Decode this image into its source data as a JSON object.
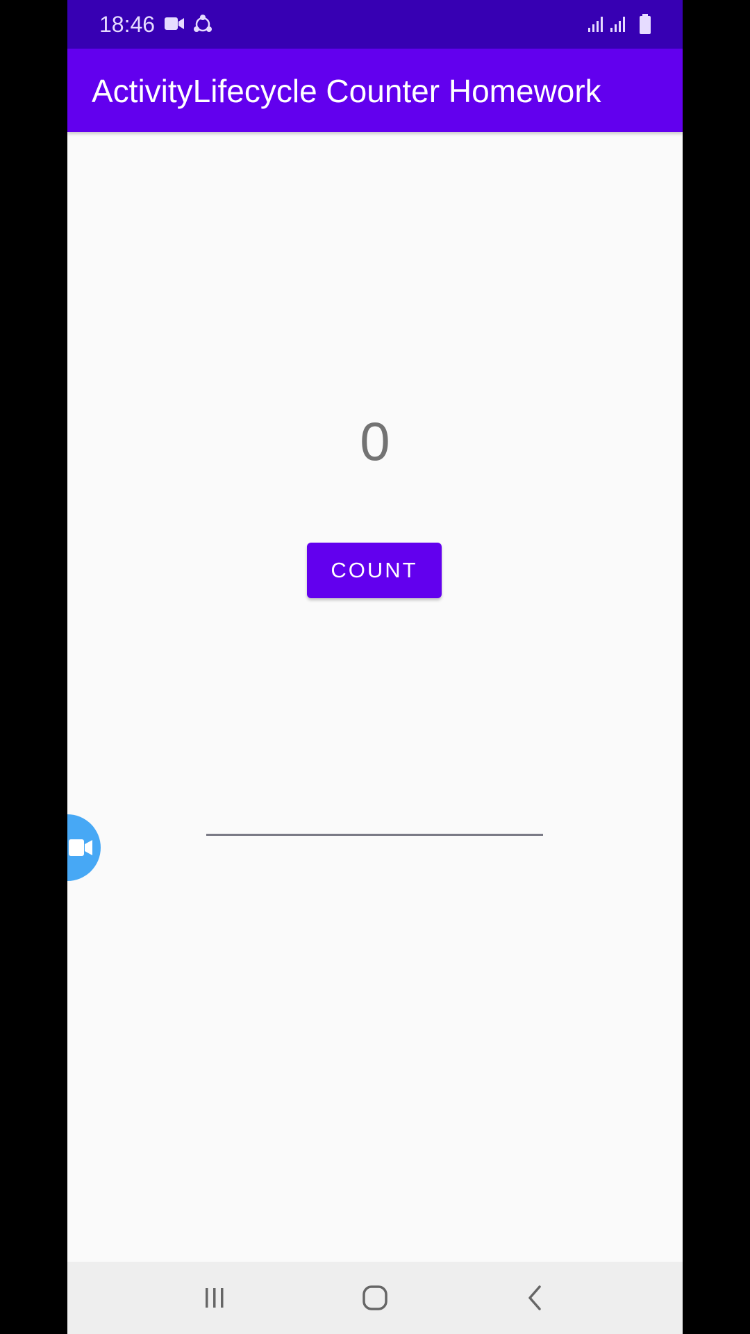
{
  "status_bar": {
    "time": "18:46",
    "icons": [
      "video-camera-icon",
      "share-icon",
      "signal-icon",
      "signal-icon",
      "battery-icon"
    ]
  },
  "app_bar": {
    "title": "ActivityLifecycle Counter Homework"
  },
  "main": {
    "count_value": "0",
    "count_button_label": "COUNT",
    "text_field_value": ""
  },
  "floating_button": {
    "icon": "video-camera-icon"
  },
  "nav_bar": {
    "buttons": [
      "recent-apps-icon",
      "home-icon",
      "back-icon"
    ]
  },
  "colors": {
    "status_bar": "#3700b3",
    "app_bar": "#6200ee",
    "button": "#6200ee",
    "background": "#fafafa",
    "floating_button": "#47a8f5",
    "nav_bar": "#eeeeee"
  }
}
